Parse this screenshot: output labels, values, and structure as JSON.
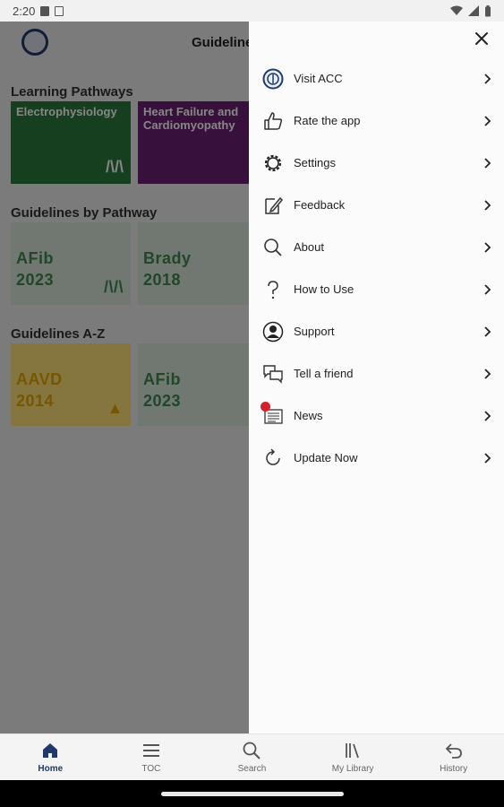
{
  "status_bar": {
    "time": "2:20"
  },
  "app": {
    "title": "Guideline",
    "sections": [
      {
        "title": "Learning Pathways",
        "cards": [
          {
            "label": "Electrophysiology",
            "color": "#2b7a3d"
          },
          {
            "label": "Heart Failure and Cardiomyopathy",
            "color": "#6b1f74"
          }
        ]
      },
      {
        "title": "Guidelines by Pathway",
        "cards": [
          {
            "label": "AFib\n2023",
            "color": "#d8e4d8",
            "text_color": "#3f8a4d"
          },
          {
            "label": "Brady\n2018",
            "color": "#d8e4d8",
            "text_color": "#3f8a4d"
          }
        ]
      },
      {
        "title": "Guidelines A-Z",
        "cards": [
          {
            "label": "AAVD\n2014",
            "color": "#ffe07a",
            "text_color": "#e0a800"
          },
          {
            "label": "AFib\n2023",
            "color": "#d8e4d8",
            "text_color": "#3f8a4d"
          }
        ]
      }
    ]
  },
  "drawer": {
    "items": [
      {
        "label": "Visit ACC",
        "icon": "acc-logo-icon"
      },
      {
        "label": "Rate the app",
        "icon": "thumbs-up-icon"
      },
      {
        "label": "Settings",
        "icon": "gear-icon"
      },
      {
        "label": "Feedback",
        "icon": "edit-note-icon"
      },
      {
        "label": "About",
        "icon": "search-icon"
      },
      {
        "label": "How to Use",
        "icon": "question-mark-icon"
      },
      {
        "label": "Support",
        "icon": "person-icon"
      },
      {
        "label": "Tell a friend",
        "icon": "chat-bubbles-icon"
      },
      {
        "label": "News",
        "icon": "newspaper-icon"
      },
      {
        "label": "Update Now",
        "icon": "refresh-icon"
      }
    ],
    "news_badge_color": "#d61f26"
  },
  "bottom_nav": {
    "items": [
      {
        "label": "Home",
        "icon": "home-icon",
        "active": true
      },
      {
        "label": "TOC",
        "icon": "menu-icon"
      },
      {
        "label": "Search",
        "icon": "search-icon"
      },
      {
        "label": "My Library",
        "icon": "library-icon"
      },
      {
        "label": "History",
        "icon": "undo-icon"
      }
    ],
    "active_color": "#1f3a6b"
  }
}
